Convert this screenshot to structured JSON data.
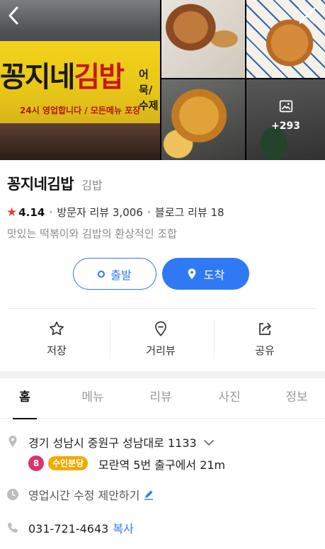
{
  "photos": {
    "main_sign": {
      "name_black": "꽁지네",
      "name_red": "김밥",
      "side_line1": "어묵/",
      "side_line2": "수제",
      "bottom": "24시 영업합니다 / 모든메뉴 포장"
    },
    "more_count": "+293"
  },
  "place": {
    "name": "꽁지네김밥",
    "category": "김밥",
    "rating": "4.14",
    "visitor_reviews": "방문자 리뷰 3,006",
    "blog_reviews": "블로그 리뷰 18",
    "description": "맛있는 떡볶이와 김밥의 환상적인 조합"
  },
  "route": {
    "depart_label": "출발",
    "arrive_label": "도착",
    "accent": "#2f7af4"
  },
  "actions": {
    "save": "저장",
    "street_view": "거리뷰",
    "share": "공유"
  },
  "tabs": [
    "홈",
    "메뉴",
    "리뷰",
    "사진",
    "정보"
  ],
  "details": {
    "address": "경기 성남시 중원구 성남대로 1133",
    "subway_line": "8",
    "subway_line_color": "#d8336e",
    "subway_tag": "수인분당",
    "subway_tag_color": "#f2a900",
    "subway_text": "모란역 5번 출구에서 21m",
    "hours_suggest": "영업시간 수정 제안하기",
    "phone": "031-721-4643",
    "copy_label": "복사"
  }
}
